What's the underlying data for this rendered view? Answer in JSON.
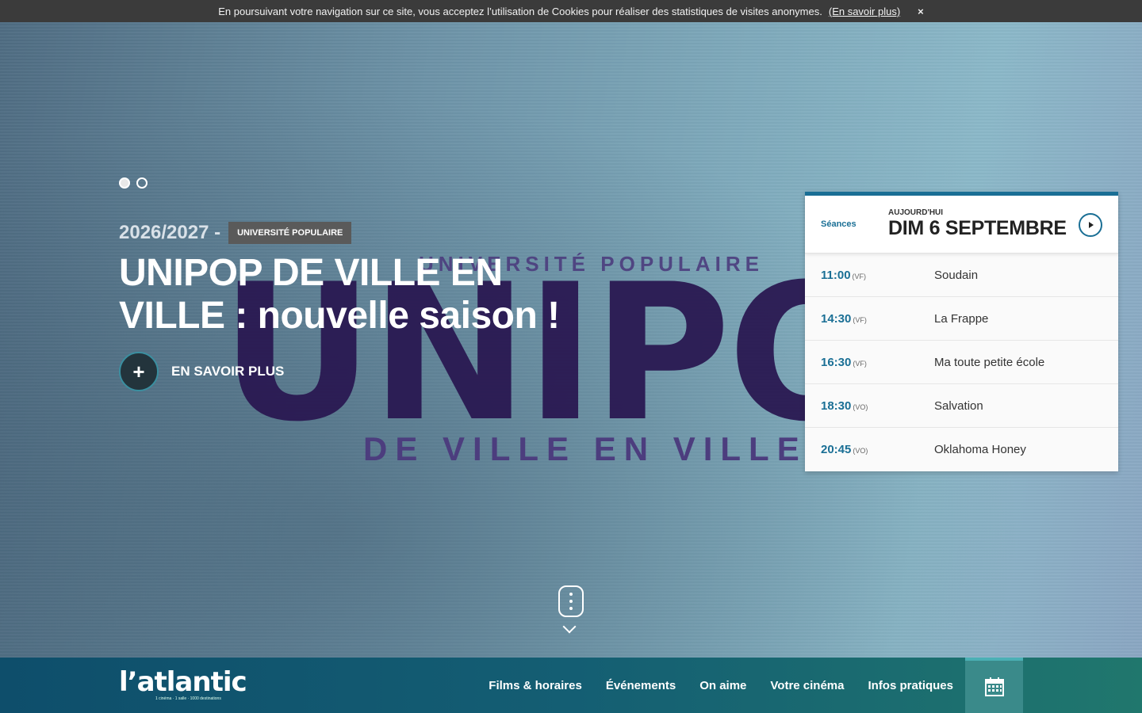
{
  "cookie": {
    "text": "En poursuivant votre navigation sur ce site, vous acceptez l’utilisation de Cookies pour réaliser des statistiques de visites anonymes.",
    "link": "(En savoir plus)",
    "close": "×"
  },
  "hero": {
    "art_top": "UNIVERSITÉ POPULAIRE",
    "art_big": "UNIPO",
    "art_big_ghost": "P",
    "art_bottom": "DE VILLE EN VILLE",
    "year": "2026/2027 -",
    "badge": "UNIVERSITÉ POPULAIRE",
    "title": "UNIPOP DE VILLE EN VILLE : nouvelle saison !",
    "more_icon": "+",
    "more_label": "EN SAVOIR PLUS",
    "slides": 2,
    "active_slide": 1
  },
  "showtimes": {
    "label": "Séances",
    "today": "AUJOURD'HUI",
    "date": "DIM 6 SEPTEMBRE",
    "rows": [
      {
        "time": "11:00",
        "version": "(VF)",
        "film": "Soudain"
      },
      {
        "time": "14:30",
        "version": "(VF)",
        "film": "La Frappe"
      },
      {
        "time": "16:30",
        "version": "(VF)",
        "film": "Ma toute petite école"
      },
      {
        "time": "18:30",
        "version": "(VO)",
        "film": "Salvation"
      },
      {
        "time": "20:45",
        "version": "(VO)",
        "film": "Oklahoma Honey"
      }
    ]
  },
  "nav": {
    "logo": "l’atlantic",
    "tagline": "1 cinéma · 1 salle · 1000 destinations",
    "items": [
      "Films & horaires",
      "Événements",
      "On aime",
      "Votre cinéma",
      "Infos pratiques"
    ],
    "calendar_icon": "calendar-icon"
  },
  "colors": {
    "accent": "#1a6f95",
    "nav_start": "#0e4e6b",
    "nav_end": "#20776d",
    "cookie_bg": "#3b3b3b"
  }
}
